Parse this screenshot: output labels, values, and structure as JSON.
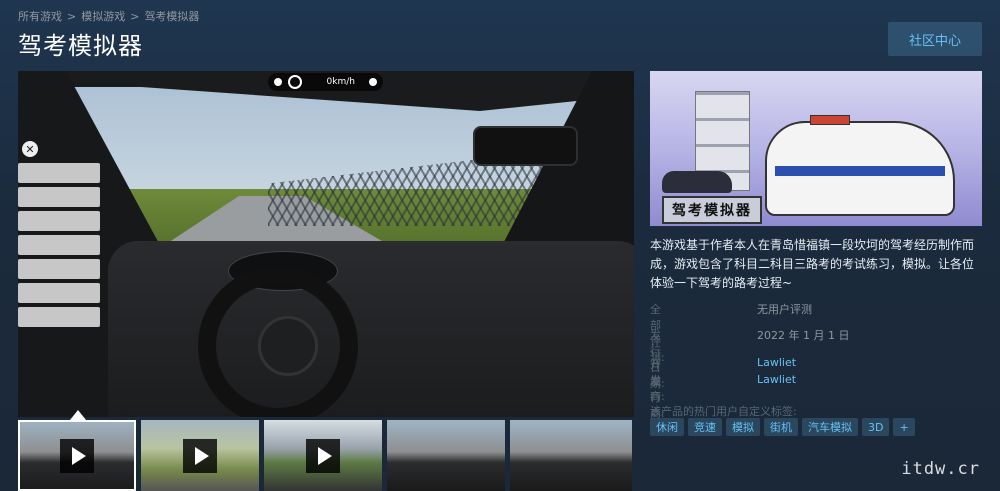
{
  "breadcrumb": [
    "所有游戏",
    "模拟游戏",
    "驾考模拟器"
  ],
  "breadcrumb_sep": ">",
  "title": "驾考模拟器",
  "community_button": "社区中心",
  "hud": {
    "speed": "0km/h"
  },
  "capsule": {
    "sign_text": "驾考模拟器"
  },
  "description": "本游戏基于作者本人在青岛惜福镇一段坎坷的驾考经历制作而成，游戏包含了科目二科目三路考的考试练习，模拟。让各位体验一下驾考的路考过程~",
  "reviews": {
    "label": "全部评测:",
    "value": "无用户评测"
  },
  "release": {
    "label": "发行日期:",
    "value": "2022 年 1 月 1 日"
  },
  "developer": {
    "label": "开发商:",
    "value": "Lawliet"
  },
  "publisher": {
    "label": "发行商:",
    "value": "Lawliet"
  },
  "tags_label": "该产品的热门用户自定义标签:",
  "tags": [
    "休闲",
    "竞速",
    "模拟",
    "街机",
    "汽车模拟",
    "3D",
    "+"
  ],
  "watermark": "itdw.cr"
}
